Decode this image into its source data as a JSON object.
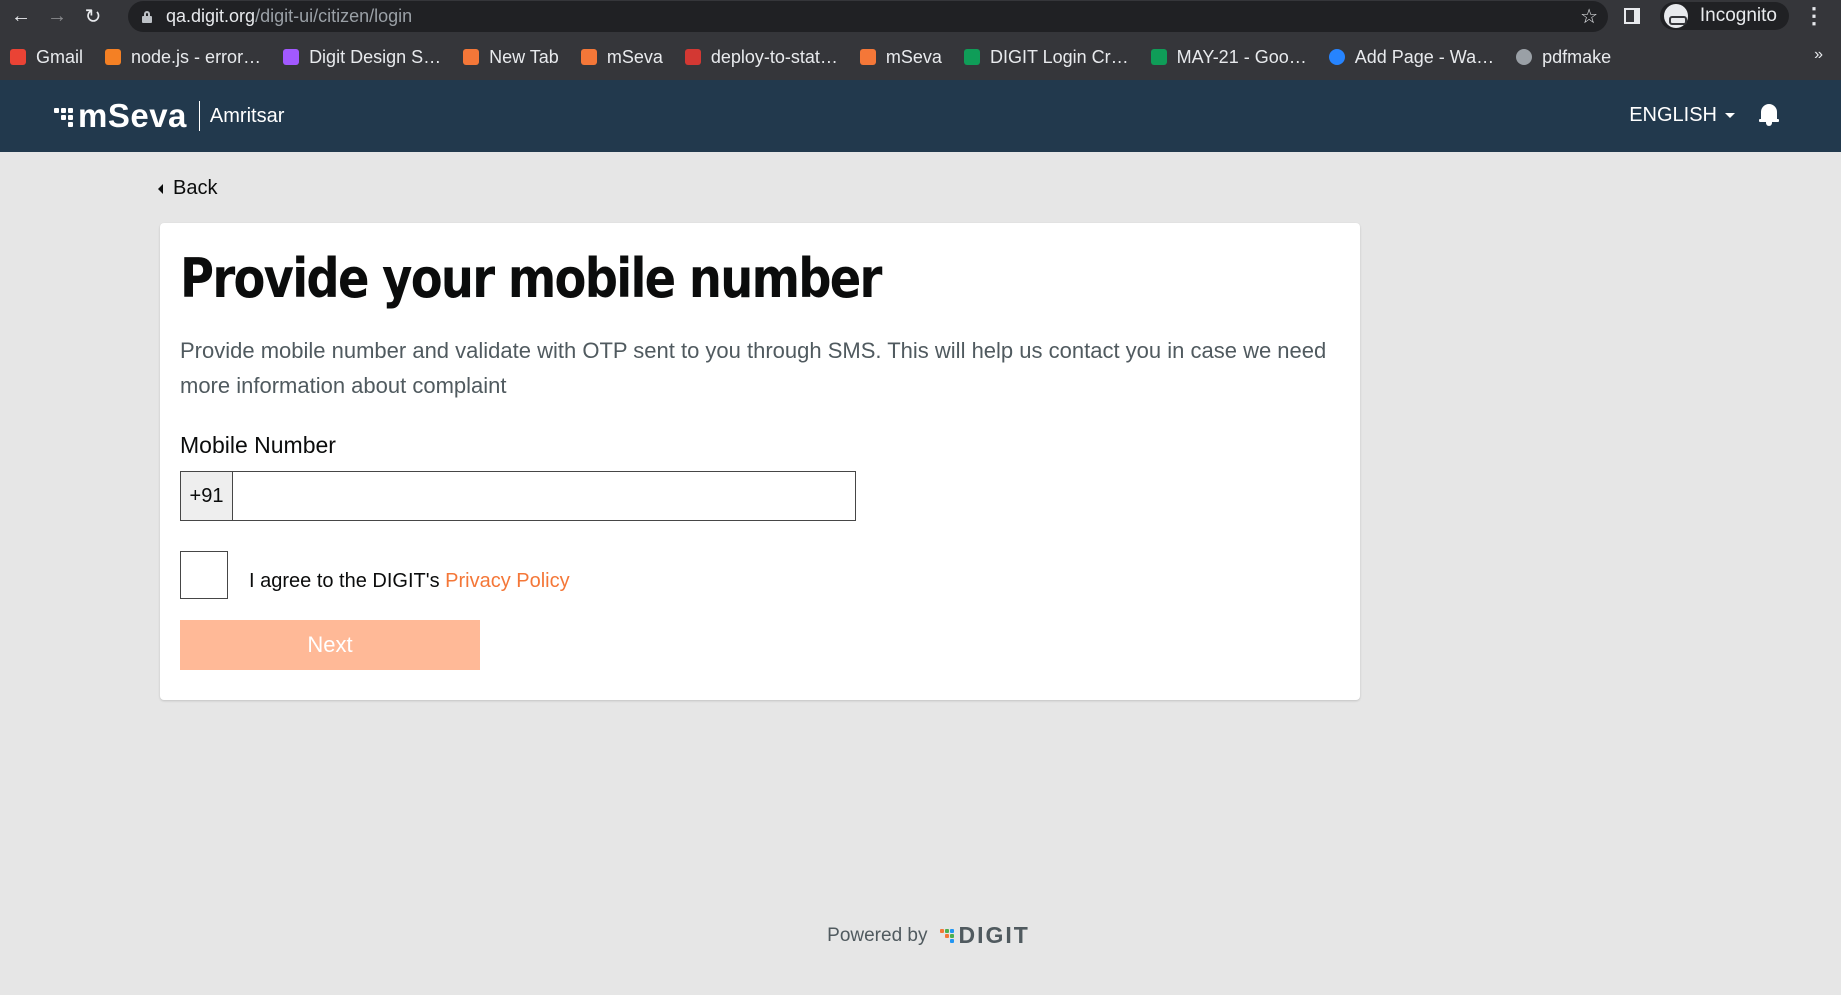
{
  "browser": {
    "url_host": "qa.digit.org",
    "url_path": "/digit-ui/citizen/login",
    "incognito_label": "Incognito",
    "bookmarks": [
      {
        "label": "Gmail",
        "icon": "gmail-icon",
        "color": "#ea4335"
      },
      {
        "label": "node.js - error…",
        "icon": "stackoverflow-icon",
        "color": "#f48024"
      },
      {
        "label": "Digit Design S…",
        "icon": "figma-icon",
        "color": "#a259ff"
      },
      {
        "label": "New Tab",
        "icon": "mseva-dots-icon",
        "color": "#f47738"
      },
      {
        "label": "mSeva",
        "icon": "mseva-dots-icon",
        "color": "#f47738"
      },
      {
        "label": "deploy-to-stat…",
        "icon": "jenkins-icon",
        "color": "#d33833"
      },
      {
        "label": "mSeva",
        "icon": "mseva-dots-icon",
        "color": "#f47738"
      },
      {
        "label": "DIGIT Login Cr…",
        "icon": "sheets-icon",
        "color": "#0f9d58"
      },
      {
        "label": "MAY-21 - Goo…",
        "icon": "sheets-icon",
        "color": "#0f9d58"
      },
      {
        "label": "Add Page - Wa…",
        "icon": "confluence-icon",
        "color": "#2684ff"
      },
      {
        "label": "pdfmake",
        "icon": "globe-icon",
        "color": "#9aa0a6"
      }
    ],
    "more_label": "»"
  },
  "header": {
    "logo_text": "mSeva",
    "city": "Amritsar",
    "language": "ENGLISH"
  },
  "back_label": "Back",
  "card": {
    "title": "Provide your mobile number",
    "description": "Provide mobile number and validate with OTP sent to you through SMS. This will help us contact you in case we need more information about complaint",
    "mobile_label": "Mobile Number",
    "country_code": "+91",
    "mobile_value": "",
    "agree_text": "I agree to the DIGIT's ",
    "privacy_link": "Privacy Policy",
    "next_label": "Next"
  },
  "footer": {
    "powered_by": "Powered by",
    "brand": "DIGIT"
  },
  "colors": {
    "header_bg": "#22394d",
    "accent": "#f47738",
    "button_disabled": "#ffb997",
    "page_bg": "#e6e6e6"
  }
}
